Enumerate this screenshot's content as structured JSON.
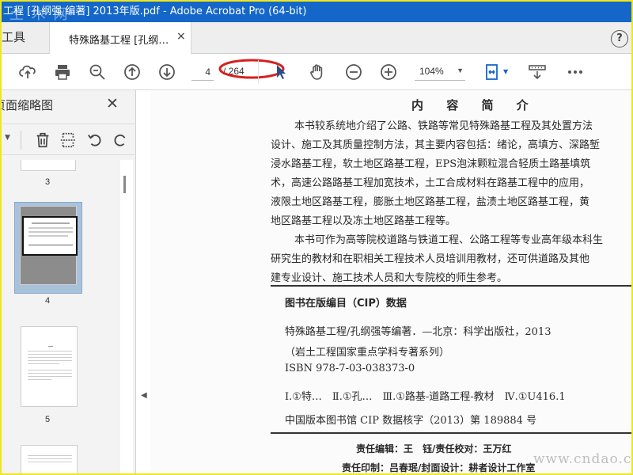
{
  "window": {
    "title": "工程 [孔纲强 编著] 2013年版.pdf - Adobe Acrobat Pro (64-bit)",
    "watermark_top": "土 木 网",
    "watermark_bottom": "www.cndao.com"
  },
  "tabs": {
    "tools_label": "工具",
    "document_label": "特殊路基工程 [孔纲…",
    "close_glyph": "×",
    "help_glyph": "?"
  },
  "toolbar": {
    "current_page": "4",
    "page_total": "/ 264",
    "zoom": "104%",
    "icons": [
      "cloud-upload-icon",
      "print-icon",
      "zoom-out-search-icon",
      "prev-page-icon",
      "next-page-icon",
      "select-cursor-icon",
      "hand-icon",
      "zoom-out-icon",
      "zoom-in-icon",
      "fit-page-icon",
      "scroll-mode-icon",
      "more-icon"
    ]
  },
  "sidepanel": {
    "title": "页面缩略图",
    "close_glyph": "✕",
    "thumbnails": [
      {
        "num": "3"
      },
      {
        "num": "4",
        "selected": true
      },
      {
        "num": "5"
      }
    ]
  },
  "document": {
    "intro_title": "内 容 简 介",
    "intro_lines": [
      "本书较系统地介绍了公路、铁路等常见特殊路基工程及其处置方法",
      "设计、施工及其质量控制方法，其主要内容包括：绪论，高填方、深路堑",
      "浸水路基工程，软土地区路基工程，EPS泡沫颗粒混合轻质土路基填筑",
      "术，高速公路路基工程加宽技术，土工合成材料在路基工程中的应用，",
      "液限土地区路基工程，膨胀土地区路基工程，盐渍土地区路基工程，黄",
      "地区路基工程以及冻土地区路基工程等。",
      "本书可作为高等院校道路与铁道工程、公路工程等专业高年级本科生",
      "研究生的教材和在职相关工程技术人员培训用教材，还可供道路及其他",
      "建专业设计、施工技术人员和大专院校的师生参考。"
    ],
    "cip_heading": "图书在版编目（CIP）数据",
    "cip_lines": [
      "特殊路基工程/孔纲强等编著．—北京：科学出版社，2013",
      "（岩土工程国家重点学科专著系列）",
      "ISBN 978-7-03-038373-0",
      "Ⅰ.①特…　Ⅱ.①孔…　Ⅲ.①路基-道路工程-教材　Ⅳ.①U416.1",
      "中国版本图书馆 CIP 数据核字（2013）第 189884 号"
    ],
    "credits": [
      "责任编辑：王　钰/责任校对：王万红",
      "责任印制：吕春珉/封面设计：耕者设计工作室"
    ]
  },
  "colors": {
    "titlebar": "#1467c8",
    "outer_border": "#f0e61e",
    "annotation_red": "#d61f1f",
    "icon_blue": "#1467c8"
  }
}
